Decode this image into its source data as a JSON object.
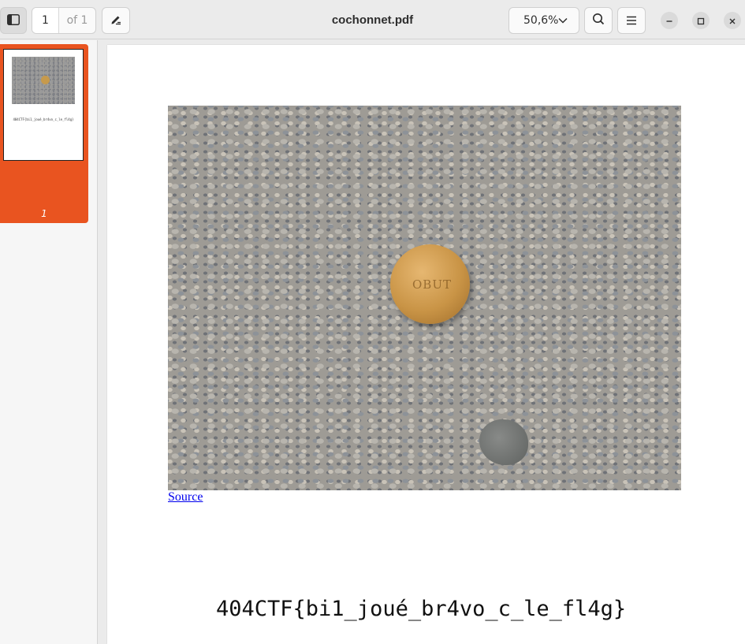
{
  "window": {
    "title": "cochonnet.pdf"
  },
  "toolbar": {
    "page_current": "1",
    "page_total": "of 1",
    "zoom": "50,6%",
    "icons": {
      "sidebar_toggle": "sidebar-icon",
      "annotate": "pencil-icon",
      "zoom_dropdown": "chevron-down-icon",
      "search": "search-icon",
      "menu": "hamburger-menu-icon",
      "minimize": "minimize-icon",
      "maximize": "maximize-icon",
      "close": "close-icon"
    }
  },
  "sidebar": {
    "thumbnails": [
      {
        "label": "1",
        "selected": true,
        "thumb_text": "404CTF{bi1_joué_br4vo_c_le_fl4g}"
      }
    ],
    "accent_color": "#e95420"
  },
  "document": {
    "ball_inscription": "OBUT",
    "link_text": "Source",
    "flag": "404CTF{bi1_joué_br4vo_c_le_fl4g}"
  }
}
